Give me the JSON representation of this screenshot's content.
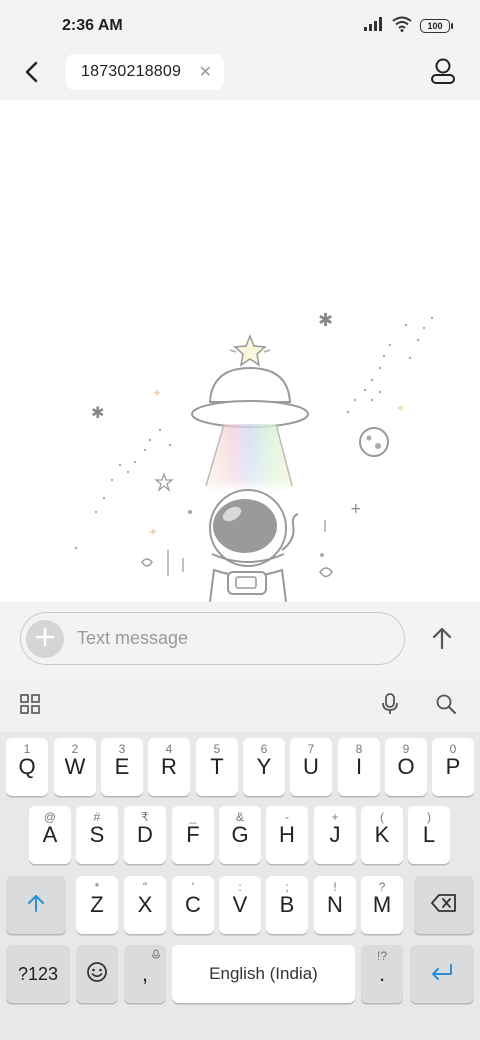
{
  "status_bar": {
    "time": "2:36 AM",
    "battery": "100",
    "icons": [
      "signal-icon",
      "wifi-icon",
      "battery-icon"
    ]
  },
  "header": {
    "recipient": "18730218809",
    "icons": [
      "back-arrow-icon",
      "close-icon",
      "contact-person-icon"
    ]
  },
  "compose": {
    "placeholder": "Text message",
    "icons": [
      "plus-icon",
      "send-arrow-icon"
    ]
  },
  "keyboard_toolbar": {
    "icons": [
      "grid-apps-icon",
      "microphone-icon",
      "search-icon"
    ]
  },
  "keyboard": {
    "row1": [
      {
        "key": "Q",
        "hint": "1"
      },
      {
        "key": "W",
        "hint": "2"
      },
      {
        "key": "E",
        "hint": "3"
      },
      {
        "key": "R",
        "hint": "4"
      },
      {
        "key": "T",
        "hint": "5"
      },
      {
        "key": "Y",
        "hint": "6"
      },
      {
        "key": "U",
        "hint": "7"
      },
      {
        "key": "I",
        "hint": "8"
      },
      {
        "key": "O",
        "hint": "9"
      },
      {
        "key": "P",
        "hint": "0"
      }
    ],
    "row2": [
      {
        "key": "A",
        "hint": "@"
      },
      {
        "key": "S",
        "hint": "#"
      },
      {
        "key": "D",
        "hint": "₹"
      },
      {
        "key": "F",
        "hint": "_"
      },
      {
        "key": "G",
        "hint": "&"
      },
      {
        "key": "H",
        "hint": "-"
      },
      {
        "key": "J",
        "hint": "+"
      },
      {
        "key": "K",
        "hint": "("
      },
      {
        "key": "L",
        "hint": ")"
      }
    ],
    "row3": [
      {
        "key": "Z",
        "hint": "*"
      },
      {
        "key": "X",
        "hint": "\""
      },
      {
        "key": "C",
        "hint": "'"
      },
      {
        "key": "V",
        "hint": ":"
      },
      {
        "key": "B",
        "hint": ";"
      },
      {
        "key": "N",
        "hint": "!"
      },
      {
        "key": "M",
        "hint": "?"
      }
    ],
    "symbols_label": "?123",
    "comma_label": ",",
    "space_label": "English (India)",
    "period_label": ".",
    "period_hint": "!?",
    "accent_color": "#2a8fd6",
    "icons": [
      "shift-arrow-icon",
      "backspace-icon",
      "emoji-icon",
      "enter-icon"
    ]
  }
}
